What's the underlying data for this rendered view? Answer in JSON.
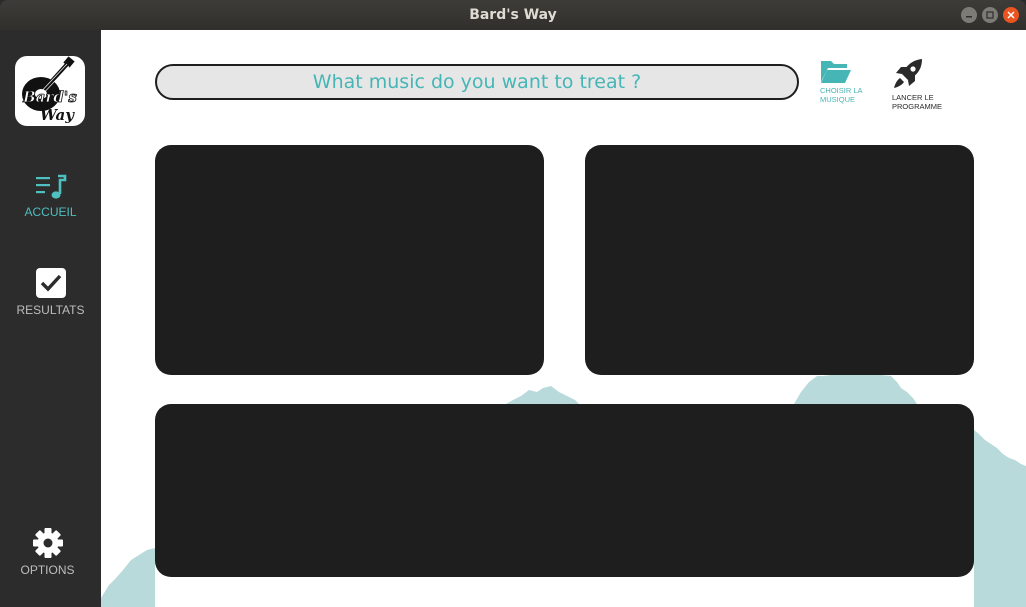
{
  "window": {
    "title": "Bard's Way"
  },
  "logo": {
    "text_line1": "Bard's",
    "text_line2": "Way"
  },
  "sidebar": {
    "items": [
      {
        "label": "ACCUEIL",
        "icon": "playlist-music-icon",
        "active": true
      },
      {
        "label": "RESULTATS",
        "icon": "checkbox-icon",
        "active": false
      },
      {
        "label": "OPTIONS",
        "icon": "gear-icon",
        "active": false
      }
    ]
  },
  "search": {
    "placeholder": "What music do you want to treat ?"
  },
  "actions": {
    "choose": {
      "label": "CHOISIR LA MUSIQUE",
      "line1": "CHOISIR LA",
      "line2": "MUSIQUE",
      "icon": "folder-icon"
    },
    "launch": {
      "label": "LANCER LE PROGRAMME",
      "line1": "LANCER LE",
      "line2": "PROGRAMME",
      "icon": "rocket-icon"
    }
  },
  "colors": {
    "accent": "#46b5b5",
    "sidebar_bg": "#2c2c2c",
    "panel_bg": "#1e1e1e",
    "mountain": "#b9dadb"
  }
}
